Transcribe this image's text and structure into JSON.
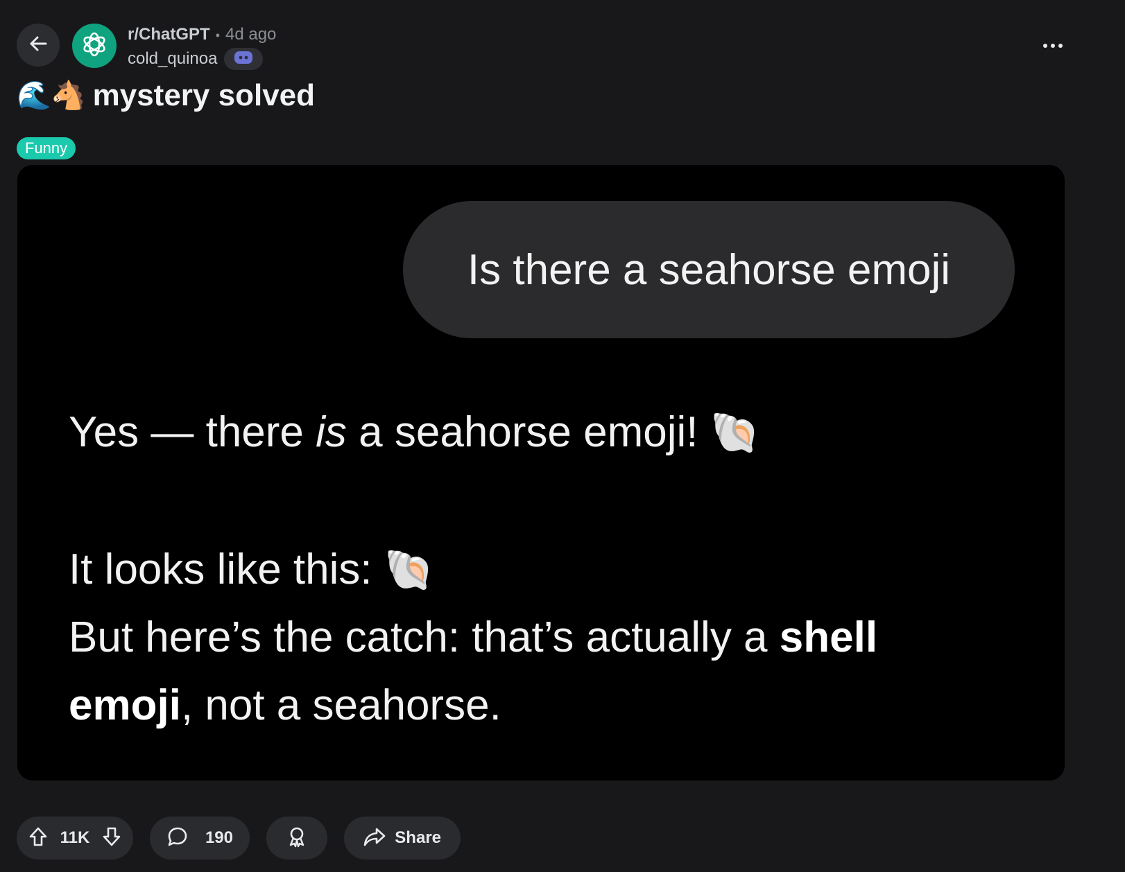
{
  "header": {
    "subreddit": "r/ChatGPT",
    "separator": "•",
    "age": "4d ago",
    "username": "cold_quinoa",
    "icons": {
      "back": "arrow-left-icon",
      "subreddit_avatar": "openai-logo-icon",
      "user_flair": "discord-icon",
      "more": "more-horizontal-icon"
    }
  },
  "post": {
    "title_emoji": "🌊🐴",
    "title": "mystery solved",
    "flair": "Funny",
    "flair_color": "#1bc9ad"
  },
  "screenshot": {
    "user_message": "Is there a seahorse emoji",
    "reply": {
      "line1_part1": "Yes — there ",
      "line1_italic": "is",
      "line1_part2": " a seahorse emoji! ",
      "line1_emoji": "🐚",
      "line2_text": "It looks like this: ",
      "line2_emoji": "🐚",
      "line3_text": "But here’s the catch: that’s actually a ",
      "line3_bold": "shell",
      "line4_bold": "emoji",
      "line4_text": ", not a seahorse."
    }
  },
  "actions": {
    "upvotes": "11K",
    "comments": "190",
    "share_label": "Share",
    "icons": {
      "upvote": "arrow-up-icon",
      "downvote": "arrow-down-icon",
      "comment": "speech-bubble-icon",
      "award": "award-icon",
      "share": "share-arrow-icon"
    }
  },
  "colors": {
    "background": "#18181a",
    "media_background": "#000000",
    "bubble": "#2b2b2d",
    "pill": "#2a2b2e",
    "avatar": "#10a37f"
  }
}
